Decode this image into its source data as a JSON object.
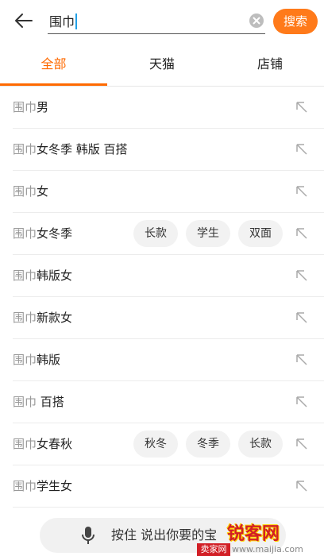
{
  "search": {
    "query": "围巾",
    "button_label": "搜索",
    "icons": {
      "back": "arrow-left-icon",
      "clear": "clear-circle-icon"
    }
  },
  "tabs": [
    {
      "label": "全部",
      "active": true
    },
    {
      "label": "天猫",
      "active": false
    },
    {
      "label": "店铺",
      "active": false
    }
  ],
  "suggestions": [
    {
      "keyword": "围巾",
      "rest": "男",
      "chips": []
    },
    {
      "keyword": "围巾",
      "rest": "女冬季 韩版 百搭",
      "chips": []
    },
    {
      "keyword": "围巾",
      "rest": "女",
      "chips": []
    },
    {
      "keyword": "围巾",
      "rest": "女冬季",
      "chips": [
        "长款",
        "学生",
        "双面"
      ]
    },
    {
      "keyword": "围巾",
      "rest": "韩版女",
      "chips": []
    },
    {
      "keyword": "围巾",
      "rest": "新款女",
      "chips": []
    },
    {
      "keyword": "围巾",
      "rest": "韩版",
      "chips": []
    },
    {
      "keyword": "围巾",
      "rest": " 百搭",
      "chips": []
    },
    {
      "keyword": "围巾",
      "rest": "女春秋",
      "chips": [
        "秋冬",
        "冬季",
        "长款"
      ]
    },
    {
      "keyword": "围巾",
      "rest": "学生女",
      "chips": []
    }
  ],
  "voice": {
    "label": "按住 说出你要的宝"
  },
  "watermark": {
    "logo": "锐客网",
    "tag": "卖家网",
    "url": "www.maijia.com"
  },
  "colors": {
    "accent": "#ff6a00",
    "button": "#ff7a1a",
    "caret": "#21a0e6"
  }
}
